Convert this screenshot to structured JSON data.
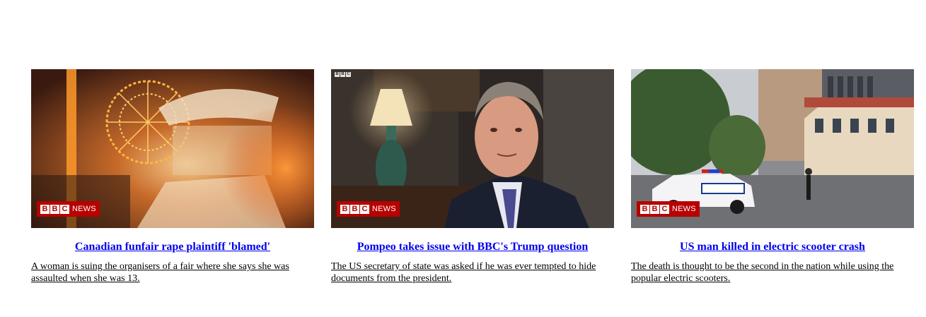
{
  "colors": {
    "link": "#0000ee",
    "bbc_red": "#b80000",
    "text": "#000000"
  },
  "badge": {
    "blocks": [
      "B",
      "B",
      "C"
    ],
    "news": "NEWS"
  },
  "articles": [
    {
      "image_icon": "funfair-photo",
      "headline": "Canadian funfair rape plaintiff 'blamed'",
      "summary": "A woman is suing the organisers of a fair where she says she was assaulted when she was 13."
    },
    {
      "image_icon": "pompeo-interview-photo",
      "headline": "Pompeo takes issue with BBC's Trump question",
      "summary": "The US secretary of state was asked if he was ever tempted to hide documents from the president."
    },
    {
      "image_icon": "police-car-street-photo",
      "headline": "US man killed in electric scooter crash",
      "summary": "The death is thought to be the second in the nation while using the popular electric scooters."
    }
  ]
}
